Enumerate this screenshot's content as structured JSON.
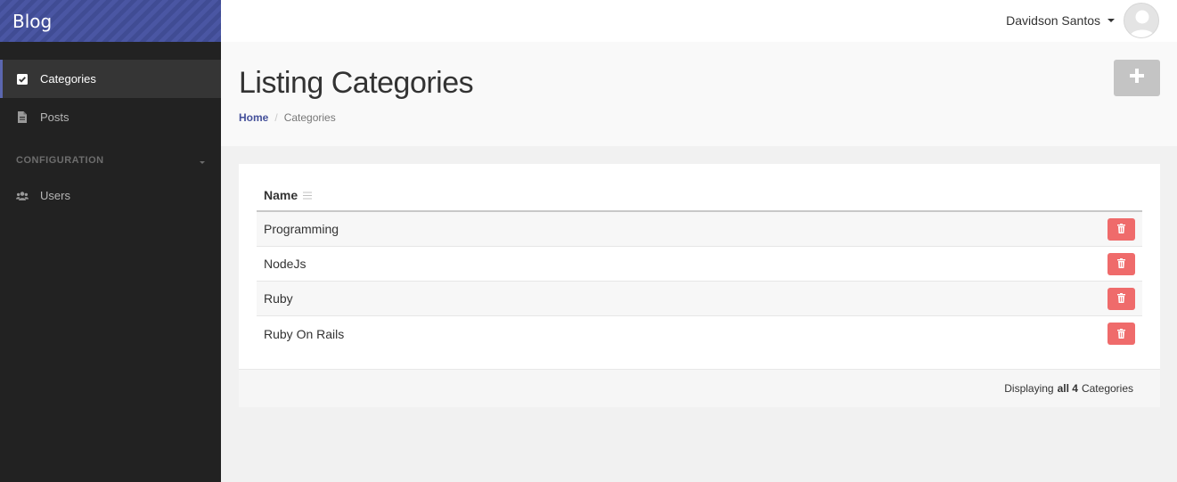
{
  "brand": {
    "title": "Blog"
  },
  "sidebar": {
    "items": [
      {
        "label": "Categories",
        "icon": "check-square-icon",
        "active": true
      },
      {
        "label": "Posts",
        "icon": "file-icon",
        "active": false
      }
    ],
    "section_header": "CONFIGURATION",
    "config_items": [
      {
        "label": "Users",
        "icon": "users-icon"
      }
    ]
  },
  "topbar": {
    "user_name": "Davidson Santos"
  },
  "header": {
    "title": "Listing Categories",
    "breadcrumb": {
      "home": "Home",
      "separator": "/",
      "current": "Categories"
    }
  },
  "table": {
    "column_name": "Name",
    "rows": [
      {
        "name": "Programming"
      },
      {
        "name": "NodeJs"
      },
      {
        "name": "Ruby"
      },
      {
        "name": "Ruby On Rails"
      }
    ]
  },
  "footer": {
    "prefix": "Displaying",
    "count_text": "all 4",
    "suffix": "Categories"
  },
  "colors": {
    "brand": "#44509a",
    "sidebar_bg": "#222222",
    "danger": "#ef6b6b",
    "add_button": "#c4c4c4"
  }
}
